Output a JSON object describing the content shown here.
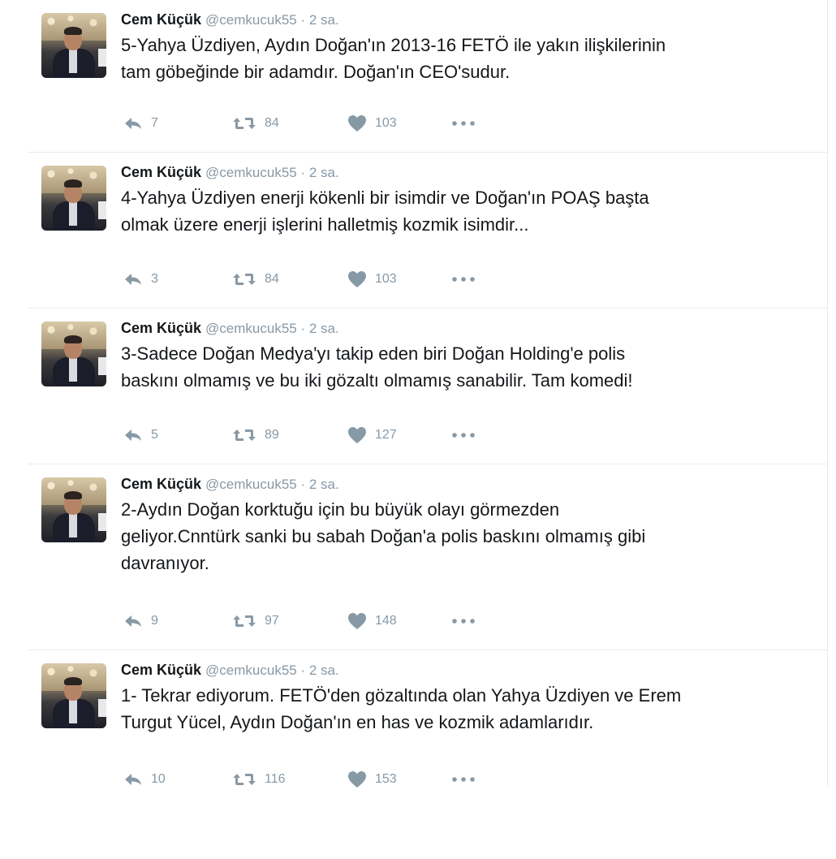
{
  "tweets": [
    {
      "name": "Cem Küçük",
      "handle": "@cemkucuk55",
      "time": "2 sa.",
      "text": "5-Yahya Üzdiyen, Aydın Doğan'ın 2013-16 FETÖ ile yakın ilişkilerinin\ntam göbeğinde bir adamdır. Doğan'ın CEO'sudur.",
      "replies": "7",
      "retweets": "84",
      "likes": "103"
    },
    {
      "name": "Cem Küçük",
      "handle": "@cemkucuk55",
      "time": "2 sa.",
      "text": "4-Yahya Üzdiyen enerji kökenli bir isimdir ve Doğan'ın POAŞ başta\nolmak üzere enerji işlerini halletmiş kozmik isimdir...",
      "replies": "3",
      "retweets": "84",
      "likes": "103"
    },
    {
      "name": "Cem Küçük",
      "handle": "@cemkucuk55",
      "time": "2 sa.",
      "text": "3-Sadece Doğan Medya'yı takip eden biri Doğan Holding'e polis\nbaskını olmamış ve bu iki gözaltı olmamış sanabilir. Tam komedi!",
      "replies": "5",
      "retweets": "89",
      "likes": "127"
    },
    {
      "name": "Cem Küçük",
      "handle": "@cemkucuk55",
      "time": "2 sa.",
      "text": "2-Aydın Doğan korktuğu için bu büyük olayı görmezden\ngeliyor.Cnntürk sanki bu sabah Doğan'a polis baskını olmamış gibi\ndavranıyor.",
      "replies": "9",
      "retweets": "97",
      "likes": "148"
    },
    {
      "name": "Cem Küçük",
      "handle": "@cemkucuk55",
      "time": "2 sa.",
      "text": "1- Tekrar ediyorum. FETÖ'den gözaltında olan Yahya Üzdiyen ve Erem\nTurgut Yücel, Aydın Doğan'ın en has ve kozmik adamlarıdır.",
      "replies": "10",
      "retweets": "116",
      "likes": "153"
    }
  ],
  "separator": " · ",
  "icons": {
    "reply": "reply-icon",
    "retweet": "retweet-icon",
    "like": "heart-icon",
    "more": "more-dots-icon"
  },
  "colors": {
    "text": "#14171a",
    "muted": "#8899a6",
    "divider": "#e6ecf0"
  }
}
